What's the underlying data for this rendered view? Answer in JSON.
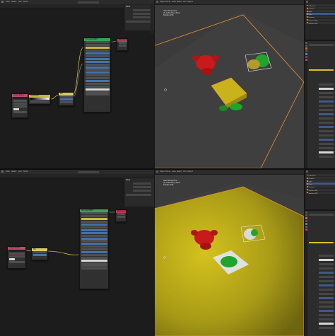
{
  "top_editor": {
    "menus": [
      "View",
      "Select",
      "Add",
      "Node"
    ],
    "npanel_title": "Node",
    "nodes": [
      {
        "title": "Principled BSDF",
        "color": "#3aa35a"
      },
      {
        "title": "Material Output",
        "color": "#c2365b"
      },
      {
        "title": "Image Texture",
        "color": "#c24a6c"
      },
      {
        "title": "ColorRamp",
        "color": "#c7b93a"
      },
      {
        "title": "Mix",
        "color": "#d8c86a"
      }
    ]
  },
  "bottom_editor": {
    "menus": [
      "View",
      "Select",
      "Add",
      "Node"
    ],
    "npanel_title": "Node",
    "nodes": [
      {
        "title": "Principled BSDF",
        "color": "#3aa35a"
      },
      {
        "title": "Material Output",
        "color": "#c2365b"
      },
      {
        "title": "Image Texture",
        "color": "#c24a6c"
      },
      {
        "title": "Mix",
        "color": "#d8c86a"
      }
    ]
  },
  "top_viewport": {
    "menus": [
      "Object Mode",
      "View",
      "Select",
      "Add",
      "Object"
    ],
    "overlay_lines": [
      "User Perspective",
      "(1) Collection | Plane",
      "Sample 4/16"
    ]
  },
  "bottom_viewport": {
    "menus": [
      "Object Mode",
      "View",
      "Select",
      "Add",
      "Object"
    ],
    "overlay_lines": [
      "User Perspective",
      "(1) Collection | Plane",
      "Sample 4/16"
    ]
  },
  "outliner": {
    "items_top": [
      "Collection",
      "Camera",
      "Light",
      "Plane",
      "Suzanne",
      "Suzanne.001",
      "Suzanne.002"
    ],
    "items_bottom": [
      "Collection",
      "Camera",
      "Light",
      "Plane",
      "Suzanne",
      "Suzanne.001",
      "Suzanne.002"
    ]
  },
  "colors": {
    "selection_orange": "#e8922f",
    "plane_yellow": "#b8a81b",
    "monkey_red": "#c81a1a",
    "monkey_green": "#1fa52b",
    "bsdf_header": "#3aa35a",
    "output_header": "#c2365b"
  },
  "icons": [
    "shader-editor-icon",
    "viewport-icon",
    "outliner-icon",
    "properties-icon",
    "material-tab-icon",
    "object-tab-icon"
  ]
}
